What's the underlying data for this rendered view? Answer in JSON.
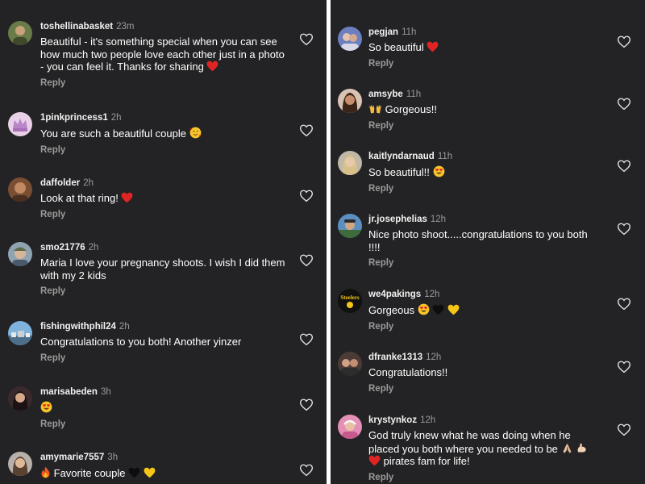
{
  "left_comments": [
    {
      "username": "toshellinabasket",
      "time": "23m",
      "text": "Beautiful - it's something special when you can see how much two people love each other just in a photo - you can feel it.  Thanks for sharing",
      "emoji": [
        "red-heart"
      ],
      "reply": "Reply",
      "avatar": "avatar-toshellinabasket"
    },
    {
      "username": "1pinkprincess1",
      "time": "2h",
      "text": "You are such a beautiful couple",
      "emoji": [
        "smiling-face-with-hearts"
      ],
      "reply": "Reply",
      "avatar": "avatar-1pinkprincess1"
    },
    {
      "username": "daffolder",
      "time": "2h",
      "text": "Look at that ring!",
      "emoji": [
        "red-heart"
      ],
      "reply": "Reply",
      "avatar": "avatar-daffolder"
    },
    {
      "username": "smo21776",
      "time": "2h",
      "text": "Maria I love your pregnancy shoots. I wish I did them with my 2 kids",
      "emoji": [],
      "reply": "Reply",
      "avatar": "avatar-smo21776"
    },
    {
      "username": "fishingwithphil24",
      "time": "2h",
      "text": "Congratulations to you both! Another yinzer",
      "emoji": [],
      "reply": "Reply",
      "avatar": "avatar-fishingwithphil24"
    },
    {
      "username": "marisabeden",
      "time": "3h",
      "text": "",
      "emoji": [
        "heart-eyes"
      ],
      "reply": "Reply",
      "avatar": "avatar-marisabeden"
    },
    {
      "username": "amymarie7557",
      "time": "3h",
      "text": "Favorite couple",
      "emoji": [
        "fire",
        "black-heart",
        "yellow-heart"
      ],
      "reply": "Reply",
      "avatar": "avatar-amymarie7557"
    }
  ],
  "right_comments": [
    {
      "username": "pegjan",
      "time": "11h",
      "text": "So beautiful",
      "emoji": [
        "red-heart"
      ],
      "reply": "Reply",
      "avatar": "avatar-pegjan"
    },
    {
      "username": "amsybe",
      "time": "11h",
      "text": "Gorgeous!!",
      "emoji": [
        "raising-hands"
      ],
      "reply": "Reply",
      "avatar": "avatar-amsybe"
    },
    {
      "username": "kaitlyndarnaud",
      "time": "11h",
      "text": "So beautiful!!",
      "emoji": [
        "heart-eyes"
      ],
      "reply": "Reply",
      "avatar": "avatar-kaitlyndarnaud"
    },
    {
      "username": "jr.josephelias",
      "time": "12h",
      "text": "Nice photo shoot.....congratulations to you both !!!!",
      "emoji": [],
      "reply": "Reply",
      "avatar": "avatar-jr-josephelias"
    },
    {
      "username": "we4pakings",
      "time": "12h",
      "text": "Gorgeous",
      "emoji": [
        "heart-eyes",
        "black-heart",
        "yellow-heart"
      ],
      "reply": "Reply",
      "avatar": "avatar-we4pakings"
    },
    {
      "username": "dfranke1313",
      "time": "12h",
      "text": "Congratulations!!",
      "emoji": [],
      "reply": "Reply",
      "avatar": "avatar-dfranke1313"
    },
    {
      "username": "krystynkoz",
      "time": "12h",
      "text": "God truly knew what he was doing when he placed you both where you needed to be",
      "text2": "pirates fam for life!",
      "emoji": [
        "folded-hands",
        "flexed-biceps"
      ],
      "emoji2": [
        "red-heart"
      ],
      "reply": "Reply",
      "avatar": "avatar-krystynkoz"
    }
  ],
  "colors": {
    "background": "#232325",
    "text": "#ffffff",
    "muted": "#9a9a9a",
    "heart_outline": "#e6e6e6"
  }
}
